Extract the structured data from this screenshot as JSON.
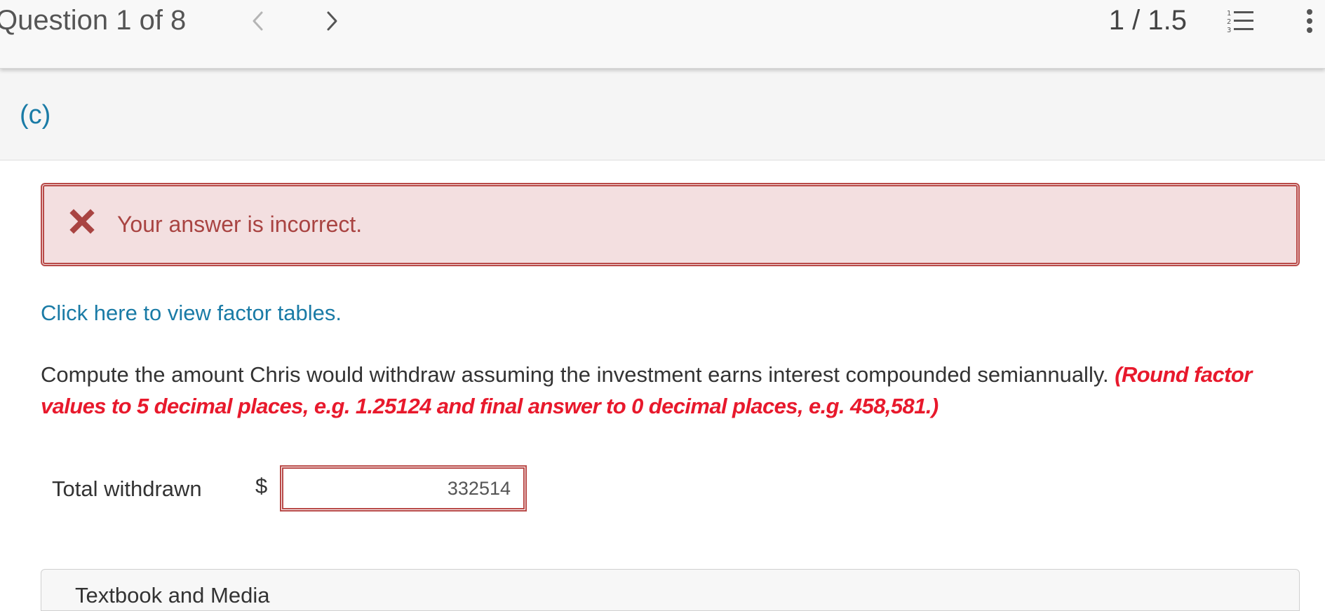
{
  "header": {
    "question_counter": "Question 1 of 8",
    "score": "1 / 1.5",
    "prev_icon": "chevron-left-icon",
    "next_icon": "chevron-right-icon",
    "list_icon": "numbered-list-icon",
    "more_icon": "vertical-dots-icon"
  },
  "part": {
    "label": "(c)"
  },
  "feedback": {
    "icon": "x-mark-icon",
    "message": "Your answer is incorrect."
  },
  "links": {
    "factor_tables": "Click here to view factor tables."
  },
  "question": {
    "text": "Compute the amount Chris would withdraw assuming the investment earns interest compounded semiannually.",
    "instruction": "(Round factor values to 5 decimal places, e.g. 1.25124 and final answer to 0 decimal places, e.g. 458,581.)"
  },
  "answer": {
    "label": "Total withdrawn",
    "currency": "$",
    "value": "332514"
  },
  "bottom_panel": {
    "title": "Textbook and Media"
  },
  "colors": {
    "link": "#1a7ba6",
    "error_text": "#a94442",
    "error_border": "#b94a48",
    "error_bg": "#f3dfe0",
    "instruction_red": "#e8192c"
  }
}
